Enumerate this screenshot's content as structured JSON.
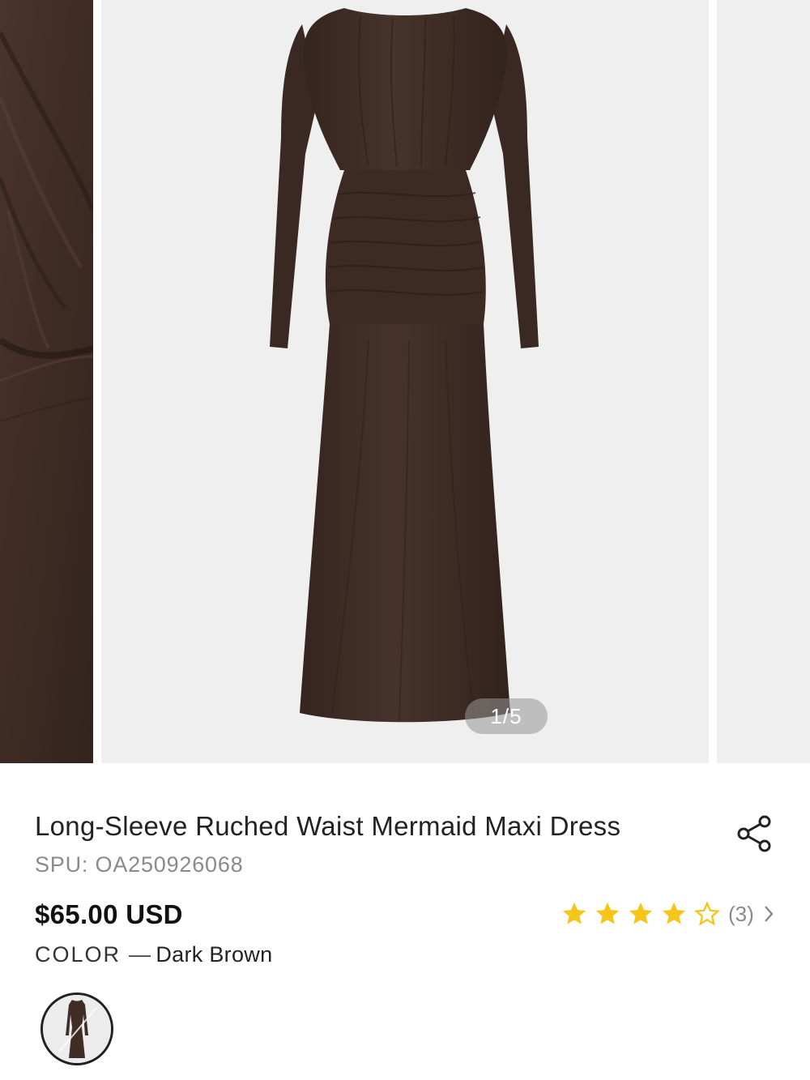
{
  "gallery": {
    "counter": "1/5",
    "current_index": 1,
    "total": 5
  },
  "product": {
    "title": "Long-Sleeve Ruched Waist Mermaid Maxi Dress",
    "spu": "SPU: OA250926068",
    "price": "$65.00 USD",
    "rating_value": 4,
    "rating_max": 5,
    "review_count": "(3)",
    "color_label": "COLOR",
    "color_separator": "—",
    "color_value": "Dark Brown"
  },
  "colors": {
    "dress": "#3f2d26",
    "star": "#f5c518",
    "counter_bg": "rgba(150,150,150,0.55)"
  },
  "icons": [
    "share-icon",
    "star-filled-icon",
    "star-outline-icon",
    "chevron-right-icon"
  ]
}
